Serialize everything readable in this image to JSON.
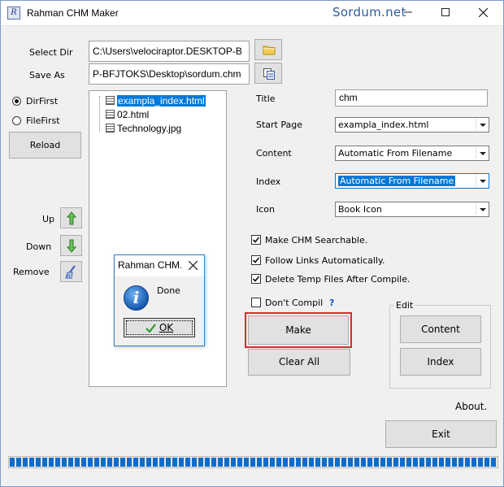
{
  "window": {
    "title": "Rahman CHM Maker",
    "watermark": "Sordum.net",
    "app_icon_glyph": "R"
  },
  "icons": {
    "folder": "folder-icon",
    "save": "save-copy-icon",
    "up": "arrow-up-icon",
    "down": "arrow-down-icon",
    "remove": "remove-broom-icon",
    "info": "info-icon",
    "check": "checkmark-icon"
  },
  "paths": {
    "select_dir_label": "Select Dir",
    "select_dir_value": "C:\\Users\\velociraptor.DESKTOP-B",
    "save_as_label": "Save As",
    "save_as_value": "P-BFJTOKS\\Desktop\\sordum.chm"
  },
  "sort": {
    "dirfirst": "DirFirst",
    "filefirst": "FileFirst",
    "selected": "DirFirst"
  },
  "buttons": {
    "reload": "Reload",
    "up": "Up",
    "down": "Down",
    "remove": "Remove",
    "make": "Make",
    "clear_all": "Clear All",
    "content": "Content",
    "index": "Index",
    "about": "About.",
    "exit": "Exit"
  },
  "files": [
    {
      "name": "exampla_index.html",
      "selected": true
    },
    {
      "name": "02.html",
      "selected": false
    },
    {
      "name": "Technology.jpg",
      "selected": false
    }
  ],
  "form": {
    "title_label": "Title",
    "title_value": "chm",
    "start_page_label": "Start Page",
    "start_page_value": "exampla_index.html",
    "content_label": "Content",
    "content_value": "Automatic From Filename",
    "index_label": "Index",
    "index_value": "Automatic From Filename",
    "icon_label": "Icon",
    "icon_value": "Book Icon"
  },
  "options": {
    "searchable": "Make CHM Searchable.",
    "searchable_checked": true,
    "follow_links": "Follow Links Automatically.",
    "follow_links_checked": true,
    "delete_temp": "Delete Temp Files After Compile.",
    "delete_temp_checked": true,
    "dont_compile": "Don't Compile",
    "dont_compile_checked": false,
    "help": "?"
  },
  "edit_group": {
    "legend": "Edit"
  },
  "dialog": {
    "title": "Rahman CHM...",
    "message": "Done",
    "ok": "OK"
  },
  "progress": {
    "fraction": 1.0
  },
  "colors": {
    "accent": "#0078d7",
    "highlight_frame": "#e0282a",
    "watermark": "#2c5d9e"
  }
}
